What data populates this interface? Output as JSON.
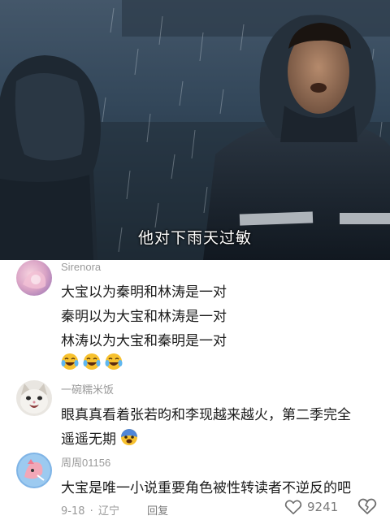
{
  "video": {
    "subtitle": "他对下雨天过敏"
  },
  "comments": [
    {
      "username": "Sirenora",
      "lines": [
        "大宝以为秦明和林涛是一对",
        "秦明以为大宝和林涛是一对",
        "林涛以为大宝和秦明是一对"
      ],
      "emoji": "crying-laughing-emoji x3"
    },
    {
      "username": "一碗糯米饭",
      "lines": [
        "眼真真看着张若昀和李现越来越火，第二季完全",
        "遥遥无期"
      ],
      "emoji": "fearful-face-emoji"
    },
    {
      "username": "周周01156",
      "lines": [
        "大宝是唯一小说重要角色被性转读者不逆反的吧"
      ],
      "meta": {
        "date": "9-18",
        "separator": "·",
        "location": "辽宁",
        "reply": "回复"
      },
      "likes": "9241"
    }
  ],
  "icons": {
    "like": "heart-outline-icon",
    "dislike": "broken-heart-icon"
  },
  "colors": {
    "text": "#1c1c1c",
    "meta": "#9a9a9a"
  }
}
